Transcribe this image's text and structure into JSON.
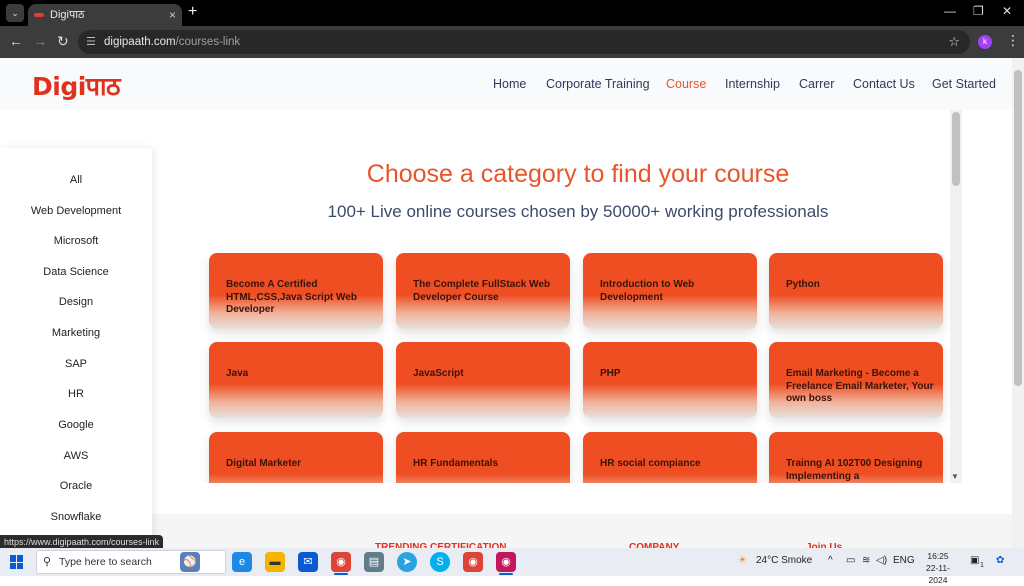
{
  "browser": {
    "tab_title": "Digiपाठ",
    "tab_close": "×",
    "new_tab": "+",
    "url_host": "digipaath.com",
    "url_path": "/courses-link",
    "profile_initial": "k",
    "status_url": "https://www.digipaath.com/courses-link"
  },
  "header": {
    "logo": "Digiपाठ",
    "nav": [
      "Home",
      "Corporate Training",
      "Course",
      "Internship",
      "Carrer",
      "Contact Us",
      "Get Started"
    ],
    "active_nav": "Course"
  },
  "sidebar": {
    "categories": [
      "All",
      "Web Development",
      "Microsoft",
      "Data Science",
      "Design",
      "Marketing",
      "SAP",
      "HR",
      "Google",
      "AWS",
      "Oracle",
      "Snowflake"
    ]
  },
  "main": {
    "headline": "Choose a category to find your course",
    "subline": "100+ Live online courses chosen by 50000+ working professionals",
    "courses": [
      "Become A Certified HTML,CSS,Java Script Web Developer",
      "The Complete FullStack Web Developer Course",
      "Introduction to Web Development",
      "Python",
      "Java",
      "JavaScript",
      "PHP",
      "Email Marketing - Become a Freelance Email Marketer, Your own boss",
      "Digital Marketer",
      "HR Fundamentals",
      "HR social compiance",
      "Trainng AI 102T00 Designing Implementing a"
    ]
  },
  "footer": {
    "headings": [
      "TRENDING CERTIFICATION",
      "COMPANY",
      "Join Us"
    ]
  },
  "taskbar": {
    "search_placeholder": "Type here to search",
    "weather": "24°C  Smoke",
    "lang": "ENG",
    "time": "16:25",
    "date": "22-11-2024",
    "notifications": "1"
  },
  "colors": {
    "brand": "#e0301e",
    "accent": "#e8552a",
    "card": "#ef4e23",
    "nav_text": "#2e3a59"
  }
}
